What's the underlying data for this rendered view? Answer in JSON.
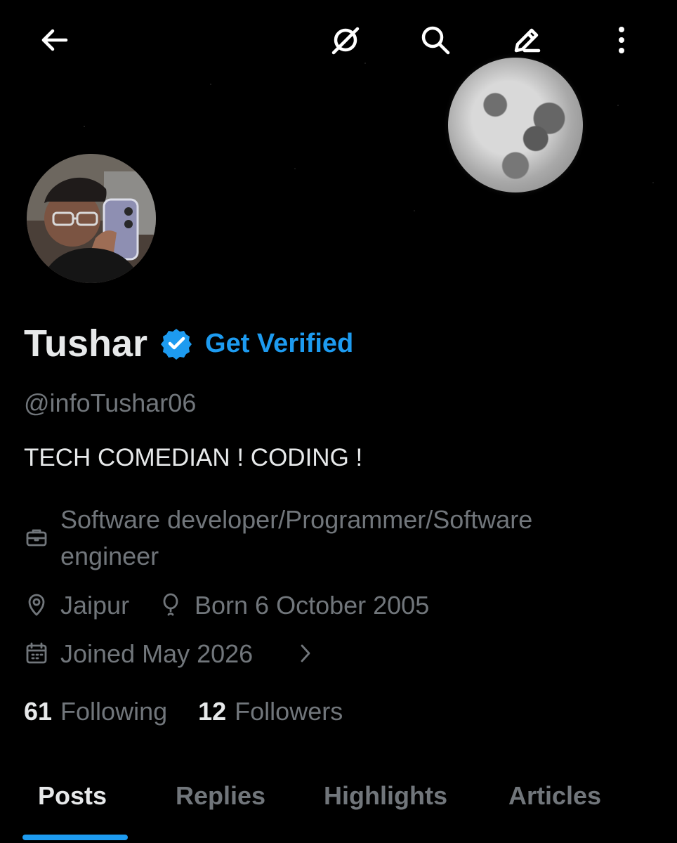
{
  "header": {
    "back_icon": "arrow-left-icon",
    "grok_icon": "grok-icon",
    "search_icon": "search-icon",
    "compose_icon": "pencil-icon",
    "more_icon": "more-vertical-icon"
  },
  "profile": {
    "name": "Tushar",
    "get_verified": "Get Verified",
    "handle": "@infoTushar06",
    "bio": "TECH COMEDIAN ! CODING !",
    "profession": "Software developer/Programmer/Software engineer",
    "profession_line1": "Software developer/Programmer/Software",
    "profession_line2": "engineer",
    "location": "Jaipur",
    "born": "Born 6 October 2005",
    "joined": "Joined May 2026",
    "following_count": "61",
    "following_label": "Following",
    "followers_count": "12",
    "followers_label": "Followers"
  },
  "tabs": [
    {
      "label": "Posts",
      "active": true
    },
    {
      "label": "Replies",
      "active": false
    },
    {
      "label": "Highlights",
      "active": false
    },
    {
      "label": "Articles",
      "active": false
    }
  ],
  "colors": {
    "background": "#000000",
    "text_primary": "#e7e9ea",
    "text_secondary": "#71767b",
    "accent": "#1d9bf0"
  }
}
